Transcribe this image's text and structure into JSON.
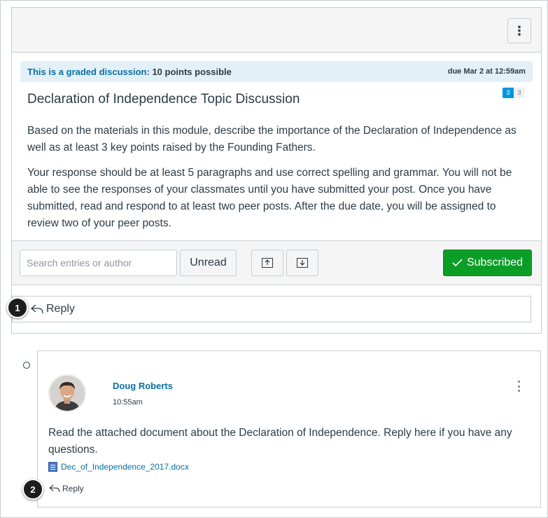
{
  "topic": {
    "graded_label": "This is a graded discussion:",
    "graded_points": "10 points possible",
    "due": "due Mar 2 at 12:59am",
    "title": "Declaration of Independence Topic Discussion",
    "unread_count": "3",
    "total_count": "3",
    "body": [
      "Based on the materials in this module, describe the importance of the Declaration of Independence as well as at least 3 key points raised by the Founding Fathers.",
      "Your response should be at least 5 paragraphs and use correct spelling and grammar. You will not be able to see the responses of your classmates until you have submitted your post. Once you have submitted, read and respond to at least two peer posts. After the due date, you will be assigned to review two of your peer posts."
    ]
  },
  "toolbar": {
    "search_placeholder": "Search entries or author",
    "unread_label": "Unread",
    "subscribed_label": "Subscribed",
    "subscribed_color": "#0b9e27"
  },
  "reply": {
    "label": "Reply"
  },
  "entry": {
    "author": "Doug Roberts",
    "time": "10:55am",
    "text": "Read the attached document about the Declaration of Independence. Reply here if you have any questions.",
    "attachment": "Dec_of_Independence_2017.docx",
    "reply_label": "Reply"
  },
  "callouts": [
    "1",
    "2"
  ],
  "colors": {
    "link": "#0770a3",
    "graded_bg": "#e4f0f8",
    "badge": "#0096db"
  }
}
